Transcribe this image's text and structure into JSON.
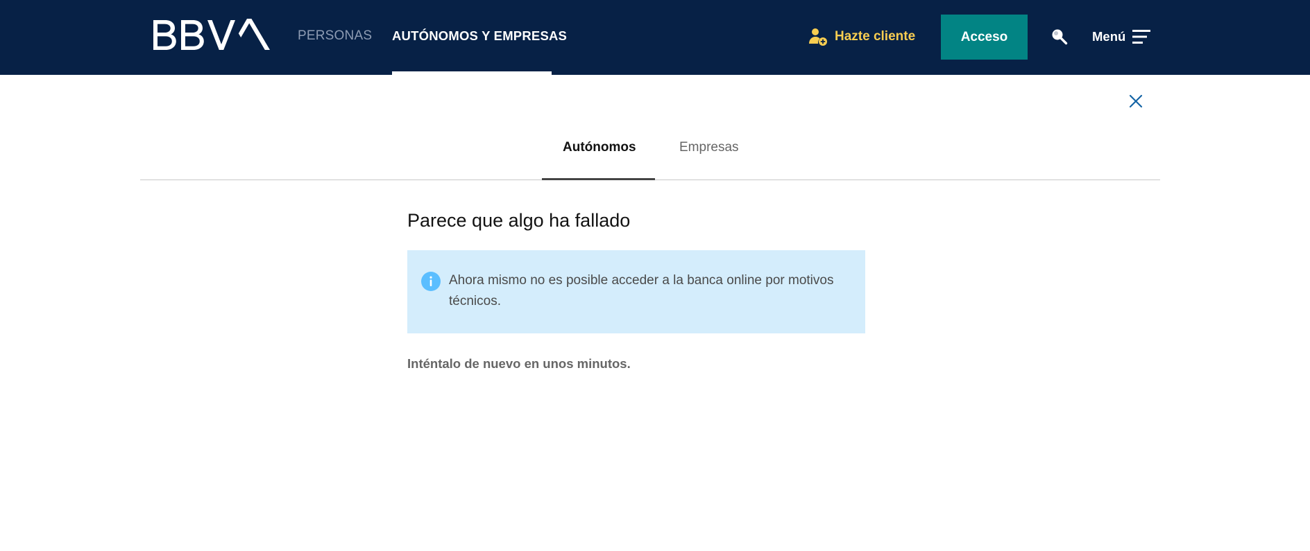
{
  "header": {
    "brand": "BBVA",
    "nav": {
      "personas": "PERSONAS",
      "autonomos_empresas": "AUTÓNOMOS Y EMPRESAS"
    },
    "hazte_cliente": "Hazte cliente",
    "acceso": "Acceso",
    "menu": "Menú"
  },
  "tabs": {
    "autonomos": "Autónomos",
    "empresas": "Empresas",
    "active": "Autónomos"
  },
  "main": {
    "title": "Parece que algo ha fallado",
    "info_message": "Ahora mismo no es posible acceder a la banca online por motivos técnicos.",
    "retry_message": "Inténtalo de nuevo en unos minutos."
  },
  "icons": {
    "user_add": "user-plus-icon",
    "search": "search-icon",
    "menu": "hamburger-menu-icon",
    "close": "close-icon",
    "info": "info-icon"
  },
  "colors": {
    "header_bg": "#072146",
    "accent_teal": "#028484",
    "hazte_yellow": "#f8cd51",
    "info_bg": "#d4edfc",
    "info_icon": "#5bbeff",
    "close_blue": "#1464a5"
  }
}
